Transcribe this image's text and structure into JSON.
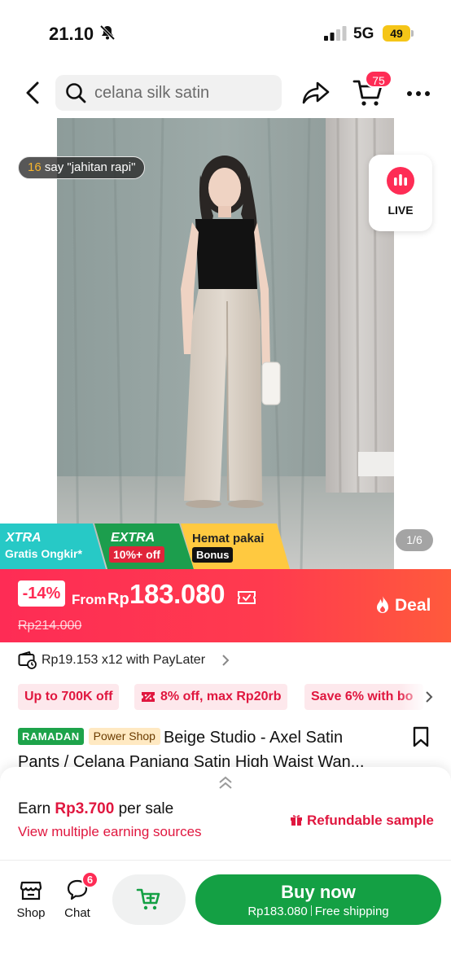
{
  "status_bar": {
    "time": "21.10",
    "network": "5G",
    "battery": "49"
  },
  "nav": {
    "search_query": "celana silk satin",
    "cart_count": "75"
  },
  "gallery": {
    "review_count": "16",
    "review_text": " say \"jahitan rapi\"",
    "live_label": "LIVE",
    "page_indicator": "1/6"
  },
  "promo": {
    "xtra_title": "XTRA",
    "xtra_sub": "Gratis Ongkir*",
    "extra_title": "EXTRA",
    "extra_sub": "10%+ off",
    "hemat_title": "Hemat pakai",
    "hemat_sub": "Bonus"
  },
  "price": {
    "discount": "-14%",
    "from_label": "From",
    "currency": "Rp",
    "amount": "183.080",
    "original": "Rp214.000",
    "deal_label": "Deal"
  },
  "paylater": {
    "text": "Rp19.153 x12 with PayLater"
  },
  "coupons": [
    {
      "label": "Up to 700K off"
    },
    {
      "label": "8% off, max Rp20rb"
    },
    {
      "label": "Save 6% with bo"
    }
  ],
  "product": {
    "tag_ramadan": "RAMADAN",
    "tag_power": "Power Shop",
    "title_line1": "Beige Studio - Axel Satin",
    "title_line2": "Pants / Celana Panjang Satin High Waist Wan..."
  },
  "affiliate": {
    "earn_prefix": "Earn ",
    "earn_amount": "Rp3.700",
    "earn_suffix": " per sale",
    "earning_sources": "View multiple earning sources",
    "refundable_sample": "Refundable sample"
  },
  "bottom_bar": {
    "shop_label": "Shop",
    "chat_label": "Chat",
    "chat_badge": "6",
    "buy_now_label": "Buy now",
    "buy_now_price": "Rp183.080",
    "buy_now_shipping": "Free shipping"
  },
  "colors": {
    "brand_red": "#fe2c55",
    "buy_green": "#14a044",
    "xtra_teal": "#27c9c6",
    "extra_green": "#1c9e4d",
    "hemat_yellow": "#ffc940"
  },
  "icons": [
    "bell-off-icon",
    "signal-icon",
    "battery-icon",
    "back-icon",
    "search-icon",
    "share-icon",
    "cart-icon",
    "more-icon",
    "live-icon",
    "coupon-icon",
    "fire-icon",
    "wallet-icon",
    "ticket-icon",
    "bookmark-icon",
    "chevron-up-icon",
    "gift-icon",
    "shop-icon",
    "chat-icon",
    "add-to-cart-icon"
  ]
}
